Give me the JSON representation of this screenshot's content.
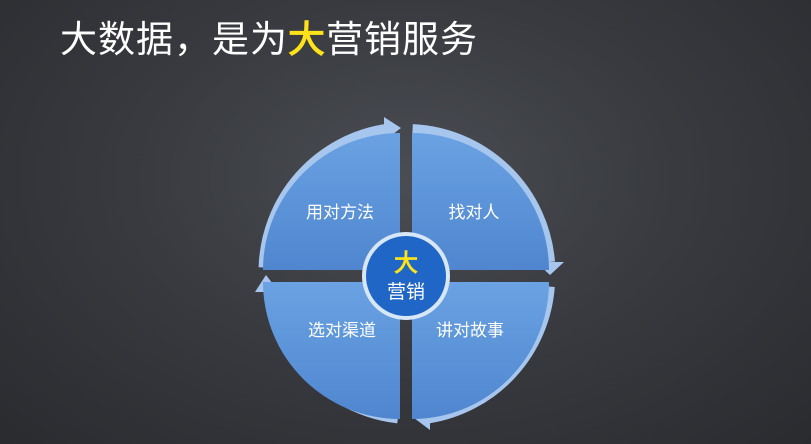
{
  "title": {
    "prefix": "大数据，是为",
    "highlight": "大",
    "suffix": "营销服务"
  },
  "center": {
    "line1": "大",
    "line2": "营销"
  },
  "quadrants": {
    "top_left": "用对方法",
    "top_right": "找对人",
    "bottom_left": "选对渠道",
    "bottom_right": "讲对故事"
  },
  "colors": {
    "background": "#393b40",
    "quadrant_fill": "#5b93d8",
    "ring": "#a7c6ee",
    "center_fill": "#1f66c7",
    "center_highlight": "#ffe31a",
    "title_highlight": "#ffe31a"
  }
}
